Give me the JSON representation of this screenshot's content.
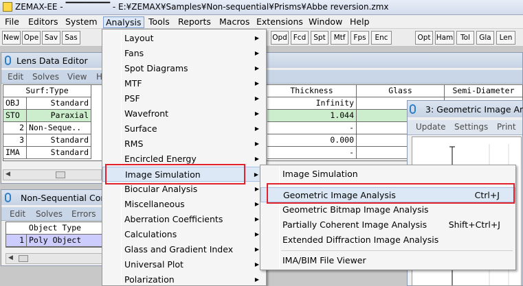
{
  "window": {
    "title": "ZEMAX-EE - ▔▔▔▔▔▔▔ - E:¥ZEMAX¥Samples¥Non-sequential¥Prisms¥Abbe reversion.zmx"
  },
  "menubar": [
    "File",
    "Editors",
    "System",
    "Analysis",
    "Tools",
    "Reports",
    "Macros",
    "Extensions",
    "Window",
    "Help"
  ],
  "toolbar": {
    "left": [
      "New",
      "Ope",
      "Sav",
      "Sas"
    ],
    "mid": [
      "Opd",
      "Fcd",
      "Spt",
      "Mtf",
      "Fps",
      "Enc"
    ],
    "right": [
      "Opt",
      "Ham",
      "Tol",
      "Gla",
      "Len"
    ]
  },
  "lens_editor": {
    "title": "Lens Data Editor",
    "menu": [
      "Edit",
      "Solves",
      "View",
      "H"
    ],
    "columns": [
      "Surf:Type",
      "Thickness",
      "Glass",
      "Semi-Diameter"
    ],
    "rows": [
      {
        "surf": "OBJ",
        "type": "Standard",
        "thickness": "Infinity"
      },
      {
        "surf": "STO",
        "type": "Paraxial",
        "thickness": "1.044"
      },
      {
        "surf": "2",
        "type": "Non-Seque..",
        "thickness": "-"
      },
      {
        "surf": "3",
        "type": "Standard",
        "thickness": "0.000"
      },
      {
        "surf": "IMA",
        "type": "Standard",
        "thickness": "-"
      }
    ]
  },
  "nsc_editor": {
    "title": "Non-Sequential Com",
    "menu": [
      "Edit",
      "Solves",
      "Errors"
    ],
    "columns": [
      "Object Type"
    ],
    "rows": [
      {
        "num": "1",
        "type": "Poly Object"
      }
    ]
  },
  "geo_window": {
    "title": "3: Geometric Image Ana",
    "menu": [
      "Update",
      "Settings",
      "Print"
    ]
  },
  "analysis_menu": {
    "items": [
      "Layout",
      "Fans",
      "Spot Diagrams",
      "MTF",
      "PSF",
      "Wavefront",
      "Surface",
      "RMS",
      "Encircled Energy",
      "Image Simulation",
      "Biocular Analysis",
      "Miscellaneous",
      "Aberration Coefficients",
      "Calculations",
      "Glass and Gradient Index",
      "Universal Plot",
      "Polarization"
    ]
  },
  "image_sim_menu": {
    "items": [
      {
        "label": "Image Simulation",
        "shortcut": ""
      },
      {
        "label": "Geometric Image Analysis",
        "shortcut": "Ctrl+J"
      },
      {
        "label": "Geometric Bitmap Image Analysis",
        "shortcut": ""
      },
      {
        "label": "Partially Coherent Image Analysis",
        "shortcut": "Shift+Ctrl+J"
      },
      {
        "label": "Extended Diffraction Image Analysis",
        "shortcut": ""
      },
      {
        "label": "IMA/BIM File Viewer",
        "shortcut": ""
      }
    ]
  },
  "colors": {
    "highlight_box": "#e0202a",
    "sto_row": "#cdeecd",
    "selected_row": "#ccccff"
  }
}
